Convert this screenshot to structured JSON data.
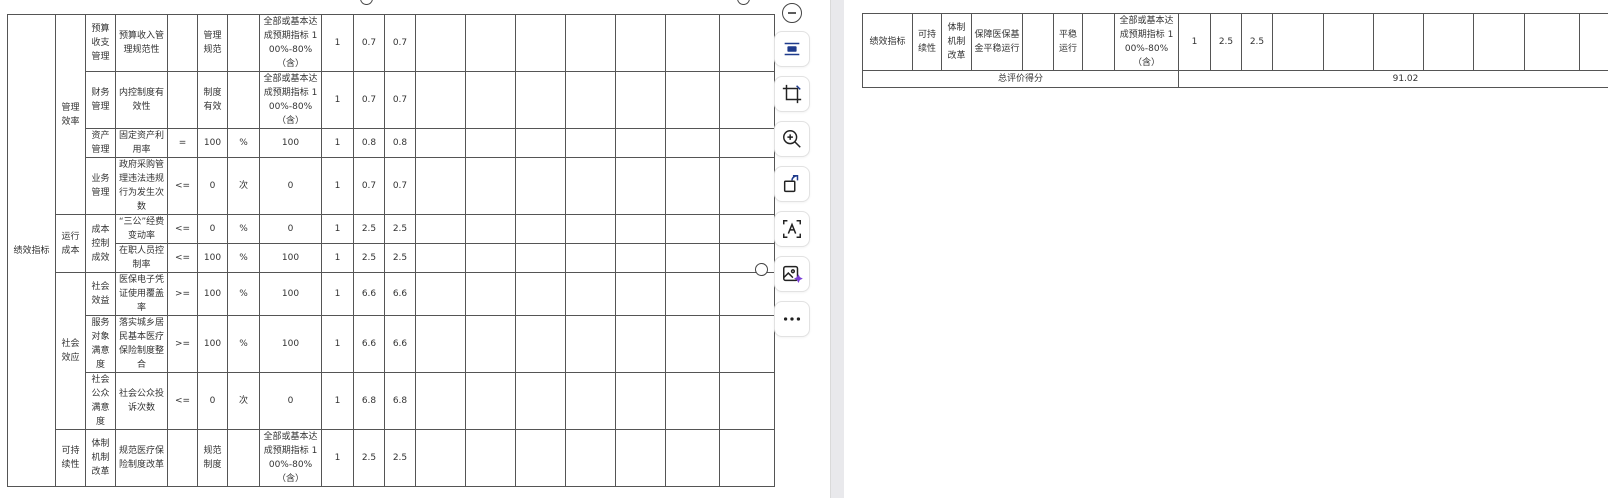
{
  "left_table": {
    "category": "绩效指标",
    "rows": [
      [
        "预算收支管理",
        "预算收入管理规范性",
        "",
        "管理规范",
        "",
        "全部或基本达成预期指标 100%-80%（含）",
        "1",
        "0.7",
        "0.7"
      ],
      [
        "财务管理",
        "内控制度有效性",
        "",
        "制度有效",
        "",
        "全部或基本达成预期指标 100%-80%（含）",
        "1",
        "0.7",
        "0.7"
      ],
      [
        "资产管理",
        "固定资产利用率",
        "=",
        "100",
        "%",
        "100",
        "1",
        "0.8",
        "0.8"
      ],
      [
        "业务管理",
        "政府采购管理违法违规行为发生次数",
        "<=",
        "0",
        "次",
        "0",
        "1",
        "0.7",
        "0.7"
      ],
      [
        "成本控制成效",
        "“三公”经费变动率",
        "<=",
        "0",
        "%",
        "0",
        "1",
        "2.5",
        "2.5"
      ],
      [
        "成本控制成效",
        "在职人员控制率",
        "<=",
        "100",
        "%",
        "100",
        "1",
        "2.5",
        "2.5"
      ],
      [
        "社会效益",
        "医保电子凭证使用覆盖率",
        ">=",
        "100",
        "%",
        "100",
        "1",
        "6.6",
        "6.6"
      ],
      [
        "服务对象满意度",
        "落实城乡居民基本医疗保险制度整合",
        ">=",
        "100",
        "%",
        "100",
        "1",
        "6.6",
        "6.6"
      ],
      [
        "社会公众满意度",
        "社会公众投诉次数",
        "<=",
        "0",
        "次",
        "0",
        "1",
        "6.8",
        "6.8"
      ],
      [
        "体制机制改革",
        "规范医疗保险制度改革",
        "",
        "规范制度",
        "",
        "全部或基本达成预期指标 100%-80%（含）",
        "1",
        "2.5",
        "2.5"
      ]
    ],
    "groups": [
      "管理效率",
      "运行成本",
      "社会效应",
      "可持续性"
    ]
  },
  "right_table": {
    "row": [
      "绩效指标",
      "可持续性",
      "体制机制改革",
      "保障医保基金平稳运行",
      "",
      "平稳运行",
      "",
      "全部或基本达成预期指标 100%-80%（含）",
      "1",
      "2.5",
      "2.5"
    ],
    "total_label": "总评价得分",
    "total_value": "91.02"
  },
  "toolbar": {
    "buttons": [
      "minus",
      "ocr-layout",
      "crop",
      "zoom-in",
      "rotate",
      "text-recognize",
      "ai-image",
      "more"
    ]
  }
}
